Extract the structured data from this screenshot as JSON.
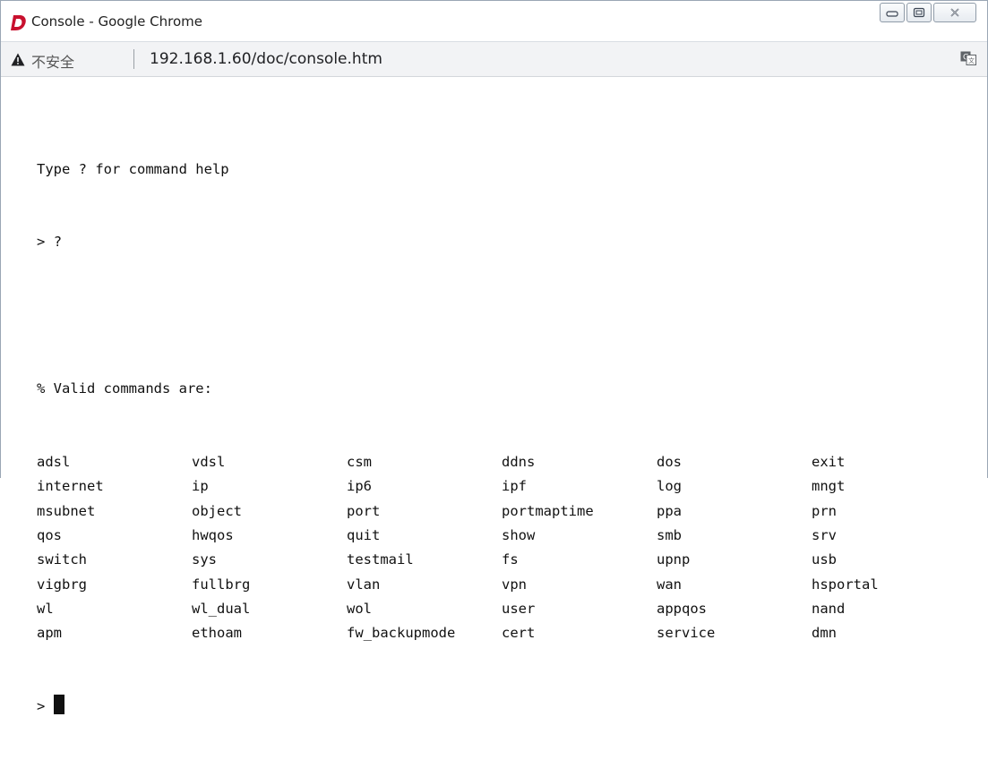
{
  "window": {
    "title": "Console - Google Chrome",
    "controls": [
      "minimize",
      "maximize",
      "close"
    ]
  },
  "address_bar": {
    "security_label": "不安全",
    "separator": "|",
    "url": "192.168.1.60/doc/console.htm",
    "warning_icon": "warning-triangle-icon",
    "translate_icon": "translate-icon"
  },
  "console": {
    "help_line": "Type ? for command help",
    "prompt_symbol": ">",
    "entered_command": "?",
    "valid_header": "% Valid commands are:",
    "commands": [
      [
        "adsl",
        "vdsl",
        "csm",
        "ddns",
        "dos",
        "exit"
      ],
      [
        "internet",
        "ip",
        "ip6",
        "ipf",
        "log",
        "mngt"
      ],
      [
        "msubnet",
        "object",
        "port",
        "portmaptime",
        "ppa",
        "prn"
      ],
      [
        "qos",
        "hwqos",
        "quit",
        "show",
        "smb",
        "srv"
      ],
      [
        "switch",
        "sys",
        "testmail",
        "fs",
        "upnp",
        "usb"
      ],
      [
        "vigbrg",
        "fullbrg",
        "vlan",
        "vpn",
        "wan",
        "hsportal"
      ],
      [
        "wl",
        "wl_dual",
        "wol",
        "user",
        "appqos",
        "nand"
      ],
      [
        "apm",
        "ethoam",
        "fw_backupmode",
        "cert",
        "service",
        "dmn"
      ]
    ]
  }
}
